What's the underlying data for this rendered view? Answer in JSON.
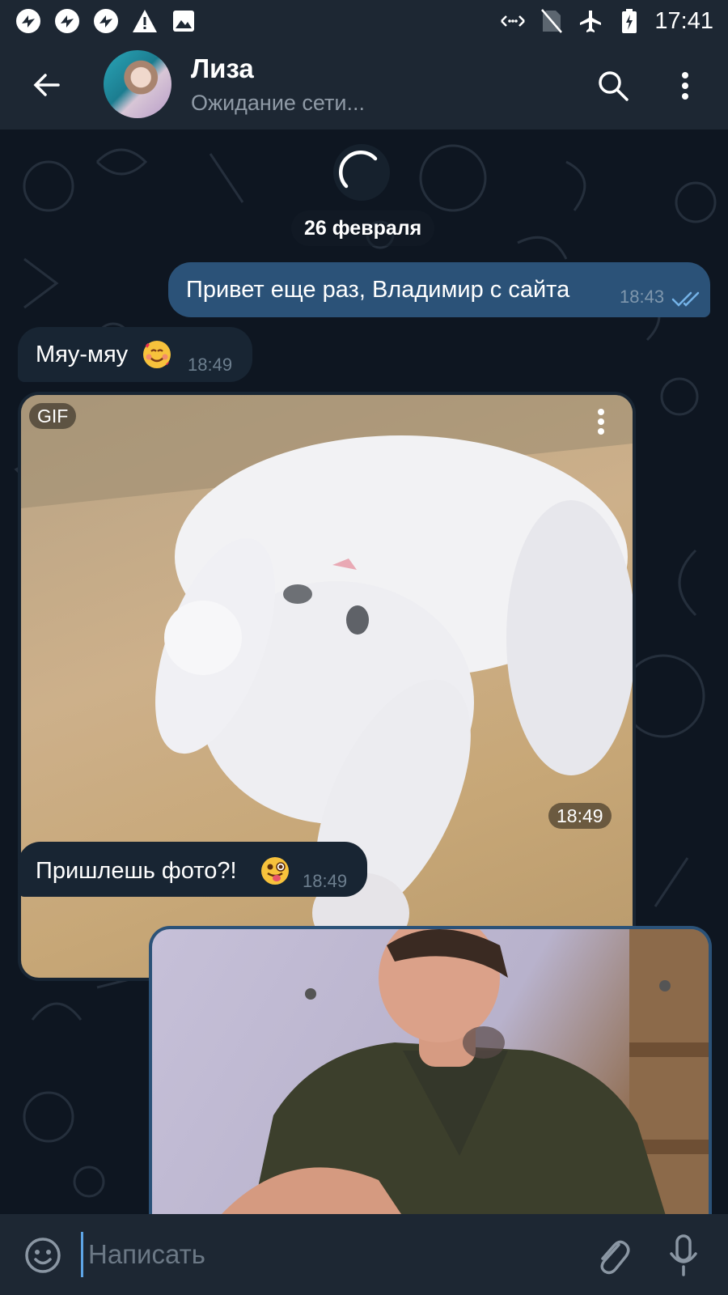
{
  "status_bar": {
    "time": "17:41",
    "left_icons": [
      "app-notification-icon",
      "app-notification-icon",
      "app-notification-icon",
      "warning-icon",
      "image-icon"
    ],
    "right_icons": [
      "data-transfer-icon",
      "no-sim-icon",
      "airplane-mode-icon",
      "battery-icon"
    ]
  },
  "header": {
    "title": "Лиза",
    "subtitle": "Ожидание сети...",
    "icons": [
      "back-arrow-icon",
      "avatar",
      "search-icon",
      "more-vert-icon"
    ]
  },
  "chat": {
    "date_chip": "26 февраля",
    "messages": [
      {
        "direction": "out",
        "text": "Привет еще раз, Владимир с сайта",
        "time": "18:43",
        "status": "read-double-check"
      },
      {
        "direction": "in",
        "text": "Мяу-мяу",
        "emoji": "smiling-face-with-hearts",
        "time": "18:49"
      },
      {
        "direction": "in",
        "type": "gif",
        "badge": "GIF",
        "time": "18:49"
      },
      {
        "direction": "in",
        "text": "Пришлешь фото?!",
        "emoji": "winking-face-with-tongue",
        "time": "18:49"
      },
      {
        "direction": "out",
        "type": "photo"
      }
    ]
  },
  "input": {
    "placeholder": "Написать",
    "icons": [
      "emoji-icon",
      "attach-icon",
      "microphone-icon"
    ]
  },
  "colors": {
    "header_bg": "#1d2733",
    "chat_bg": "#0e1621",
    "outgoing_bubble": "#2b5278",
    "incoming_bubble": "#182533",
    "accent": "#5ea5e6"
  }
}
